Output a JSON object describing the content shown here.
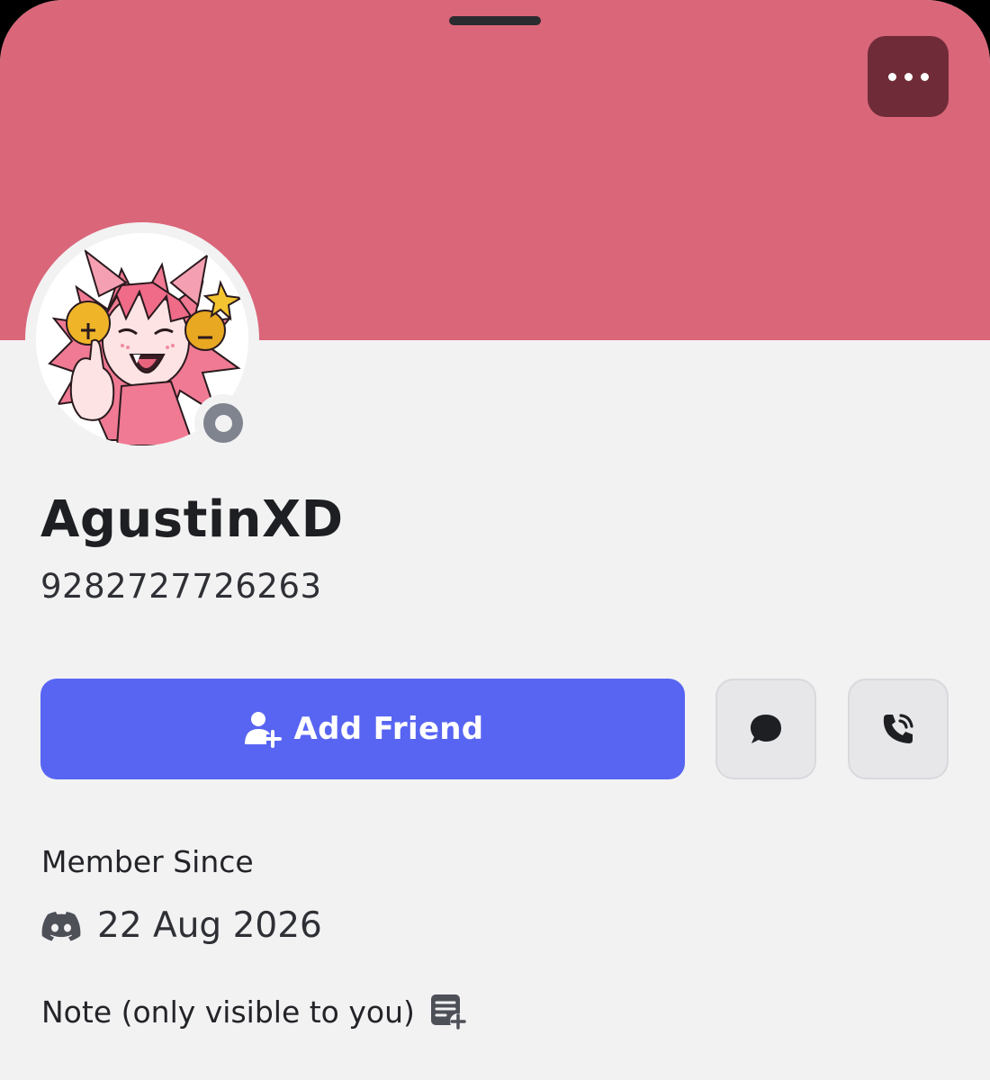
{
  "profile": {
    "display_name": "AgustinXD",
    "username": "9282727726263",
    "status": "offline",
    "avatar_icon": "anime-avatar-image"
  },
  "colors": {
    "banner": "#da6679",
    "more_button": "#6f2c38",
    "primary_button": "#5865f2",
    "background": "#f2f2f3",
    "status_offline": "#80848e"
  },
  "actions": {
    "add_friend_label": "Add Friend",
    "add_friend_icon": "add-user-icon",
    "message_icon": "chat-bubble-icon",
    "call_icon": "phone-call-icon",
    "more_icon": "more-dots-icon"
  },
  "member_since": {
    "heading": "Member Since",
    "date": "22 Aug 2026",
    "icon": "discord-logo-icon"
  },
  "note": {
    "label": "Note (only visible to you)",
    "icon": "add-note-icon"
  }
}
